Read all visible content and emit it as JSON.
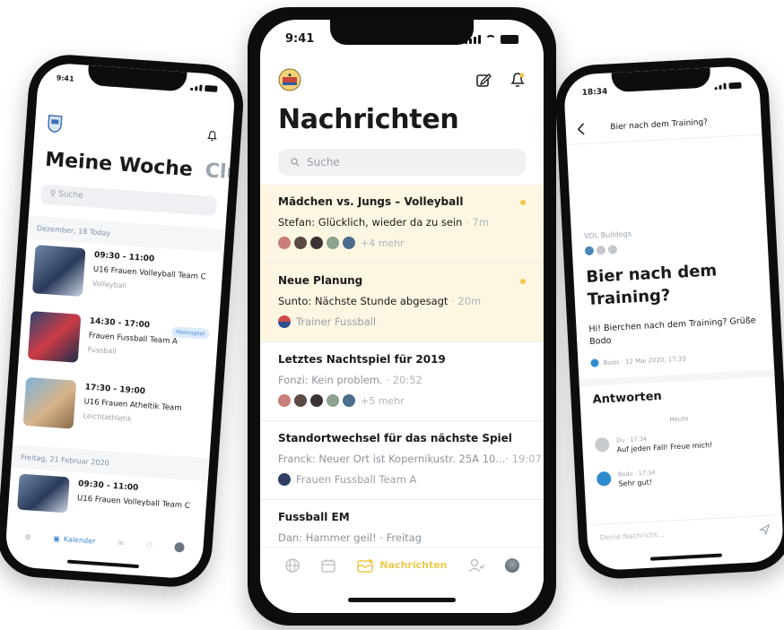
{
  "colors": {
    "accent_yellow": "#f0c94a",
    "accent_blue": "#3d86d6",
    "unread_bg": "#fdf6e2"
  },
  "left_phone": {
    "status_time": "9:41",
    "title": "Meine Woche",
    "title_secondary": "Club",
    "search_placeholder": "Suche",
    "date_header_1": "Dezember, 18 Today",
    "date_header_2": "Freitag, 21 Februar 2020",
    "events": [
      {
        "time": "09:30 - 11:00",
        "name": "U16 Frauen Volleyball Team C",
        "category": "Volleyball",
        "badge": ""
      },
      {
        "time": "14:30 - 17:00",
        "name": "Frauen Fussball Team A",
        "category": "Fussball",
        "badge": "Heimspiel"
      },
      {
        "time": "17:30 - 19:00",
        "name": "U16 Frauen Atheltik Team",
        "category": "Leichtathletik",
        "badge": ""
      },
      {
        "time": "09:30 - 11:00",
        "name": "U16 Frauen Volleyball Team C",
        "category": "",
        "badge": ""
      }
    ],
    "tab_active_label": "Kalender"
  },
  "center_phone": {
    "status_time": "9:41",
    "title": "Nachrichten",
    "search_placeholder": "Suche",
    "messages": [
      {
        "title": "Mädchen vs. Jungs – Volleyball",
        "sender_text": "Stefan: Glücklich, wieder da zu sein",
        "time": "· 7m",
        "more": "+4 mehr",
        "team": "",
        "unread": true
      },
      {
        "title": "Neue Planung",
        "sender_text": "Sunto: Nächste Stunde abgesagt",
        "time": "· 20m",
        "more": "",
        "team": "Trainer Fussball",
        "unread": true
      },
      {
        "title": "Letztes Nachtspiel für 2019",
        "sender_text": "Fonzi: Kein problem.",
        "time": "· 20:52",
        "more": "+5 mehr",
        "team": "",
        "unread": false
      },
      {
        "title": "Standortwechsel für das nächste Spiel",
        "sender_text": "Franck: Neuer Ort ist Kopernikustr. 25A 10...",
        "time": "· 19:07",
        "more": "",
        "team": "Frauen Fussball Team A",
        "unread": false
      },
      {
        "title": "Fussball EM",
        "sender_text": "Dan: Hammer geil! · Freitag",
        "time": "",
        "more": "",
        "team": "",
        "unread": false
      }
    ],
    "tab_active_label": "Nachrichten"
  },
  "right_phone": {
    "status_time": "18:34",
    "nav_title": "Bier nach dem Training?",
    "club": "VDL Bulldogs",
    "heading": "Bier nach dem Training?",
    "body": "Hi! Bierchen nach dem Training? Grüße Bodo",
    "meta": "Bodo · 12 Mai 2020, 17:33",
    "answers_title": "Antworten",
    "day_label": "Heute",
    "replies": [
      {
        "meta": "Du · 17:34",
        "text": "Auf jeden Fall! Freue mich!"
      },
      {
        "meta": "Bodo · 17:34",
        "text": "Sehr gut!"
      }
    ],
    "input_placeholder": "Deine Nachricht..."
  }
}
